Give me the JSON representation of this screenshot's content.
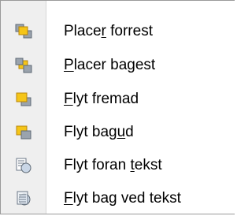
{
  "menu": {
    "items": [
      {
        "pre": "Place",
        "mn": "r",
        "post": " forrest",
        "icon": "bring-to-front-icon"
      },
      {
        "pre": "",
        "mn": "P",
        "post": "lacer bagest",
        "icon": "send-to-back-icon"
      },
      {
        "pre": "",
        "mn": "F",
        "post": "lyt fremad",
        "icon": "bring-forward-icon"
      },
      {
        "pre": "Flyt bag",
        "mn": "u",
        "post": "d",
        "icon": "send-backward-icon"
      },
      {
        "pre": "Flyt foran ",
        "mn": "t",
        "post": "ekst",
        "icon": "in-front-of-text-icon"
      },
      {
        "pre": "",
        "mn": "F",
        "post": "lyt bag ved tekst",
        "icon": "behind-text-icon"
      }
    ]
  },
  "colors": {
    "gutter": "#efefef",
    "border": "#9a9a9a",
    "shape_yellow": "#f5c518",
    "shape_grey": "#9aa3ad"
  }
}
